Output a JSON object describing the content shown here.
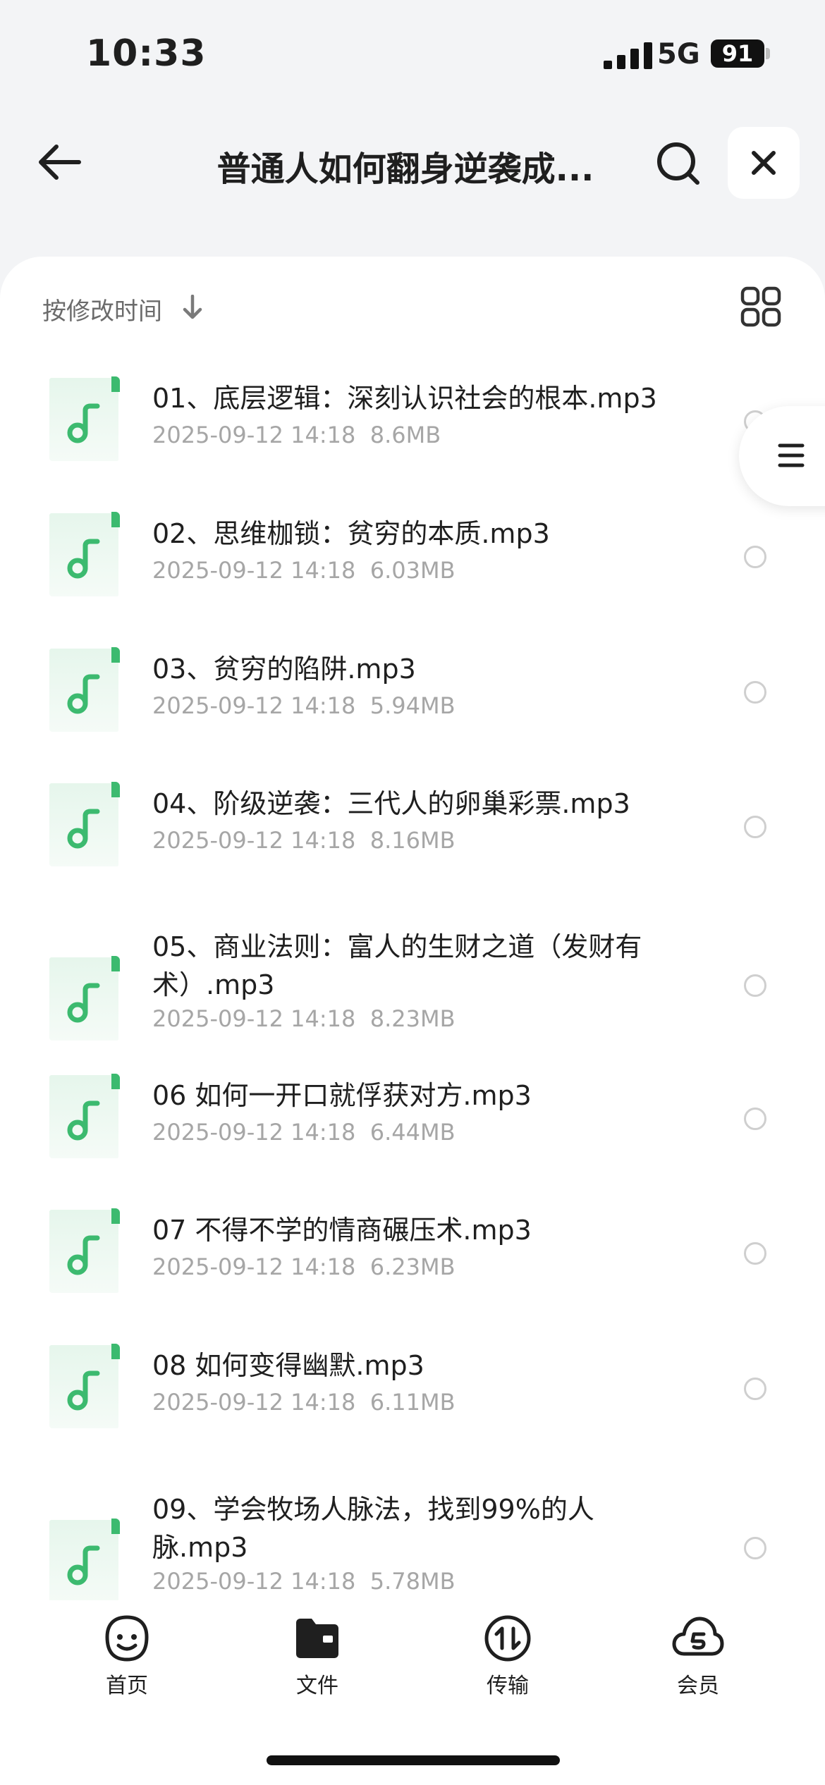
{
  "status_bar": {
    "time": "10:33",
    "network": "5G",
    "battery": "91"
  },
  "nav": {
    "title": "普通人如何翻身逆袭成..."
  },
  "sort": {
    "label": "按修改时间"
  },
  "files": [
    {
      "name": "01、底层逻辑：深刻认识社会的根本.mp3",
      "date": "2025-09-12 14:18",
      "size": "8.6MB"
    },
    {
      "name": "02、思维枷锁：贫穷的本质.mp3",
      "date": "2025-09-12 14:18",
      "size": "6.03MB"
    },
    {
      "name": "03、贫穷的陷阱.mp3",
      "date": "2025-09-12 14:18",
      "size": "5.94MB"
    },
    {
      "name": "04、阶级逆袭：三代人的卵巢彩票.mp3",
      "date": "2025-09-12 14:18",
      "size": "8.16MB"
    },
    {
      "name": "05、商业法则：富人的生财之道（发财有术）.mp3",
      "date": "2025-09-12 14:18",
      "size": "8.23MB"
    },
    {
      "name": "06 如何一开口就俘获对方.mp3",
      "date": "2025-09-12 14:18",
      "size": "6.44MB"
    },
    {
      "name": "07 不得不学的情商碾压术.mp3",
      "date": "2025-09-12 14:18",
      "size": "6.23MB"
    },
    {
      "name": "08 如何变得幽默.mp3",
      "date": "2025-09-12 14:18",
      "size": "6.11MB"
    },
    {
      "name": "09、学会牧场人脉法，找到99%的人脉.mp3",
      "date": "2025-09-12 14:18",
      "size": "5.78MB"
    }
  ],
  "tabs": [
    {
      "label": "首页",
      "icon": "smile-face-icon"
    },
    {
      "label": "文件",
      "icon": "folder-icon"
    },
    {
      "label": "传输",
      "icon": "transfer-icon"
    },
    {
      "label": "会员",
      "icon": "cloud-vip-icon"
    }
  ],
  "colors": {
    "accent_green": "#3cba6f",
    "background": "#f3f4f6"
  }
}
